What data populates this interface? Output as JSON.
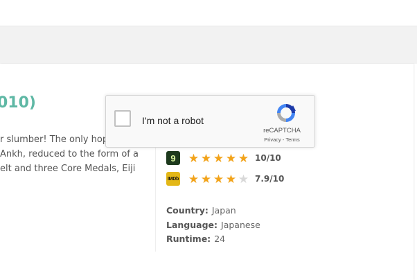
{
  "movie": {
    "title_fragment": "010)",
    "synopsis_lines": [
      "r slumber! The only hop",
      "Ankh, reduced to the form of a",
      "elt and three Core Medals, Eiji"
    ]
  },
  "ratings": [
    {
      "source_icon": "site-rating-logo-icon",
      "logo_text": "9",
      "stars_full": 5,
      "stars_total": 5,
      "score": "10/10",
      "value": 10
    },
    {
      "source_icon": "imdb-logo-icon",
      "logo_text": "IMDb",
      "stars_full": 4,
      "stars_total": 5,
      "score": "7.9/10",
      "value": 7.9
    }
  ],
  "details": [
    {
      "label": "Country:",
      "value": "Japan"
    },
    {
      "label": "Language:",
      "value": "Japanese"
    },
    {
      "label": "Runtime:",
      "value": "24"
    }
  ],
  "captcha": {
    "label": "I'm not a robot",
    "brand": "reCAPTCHA",
    "privacy": "Privacy",
    "separator": " - ",
    "terms": "Terms",
    "checked": false
  },
  "colors": {
    "title": "#5fb8a5",
    "star_full": "#f2a31a",
    "star_empty": "#d8d8d8"
  }
}
